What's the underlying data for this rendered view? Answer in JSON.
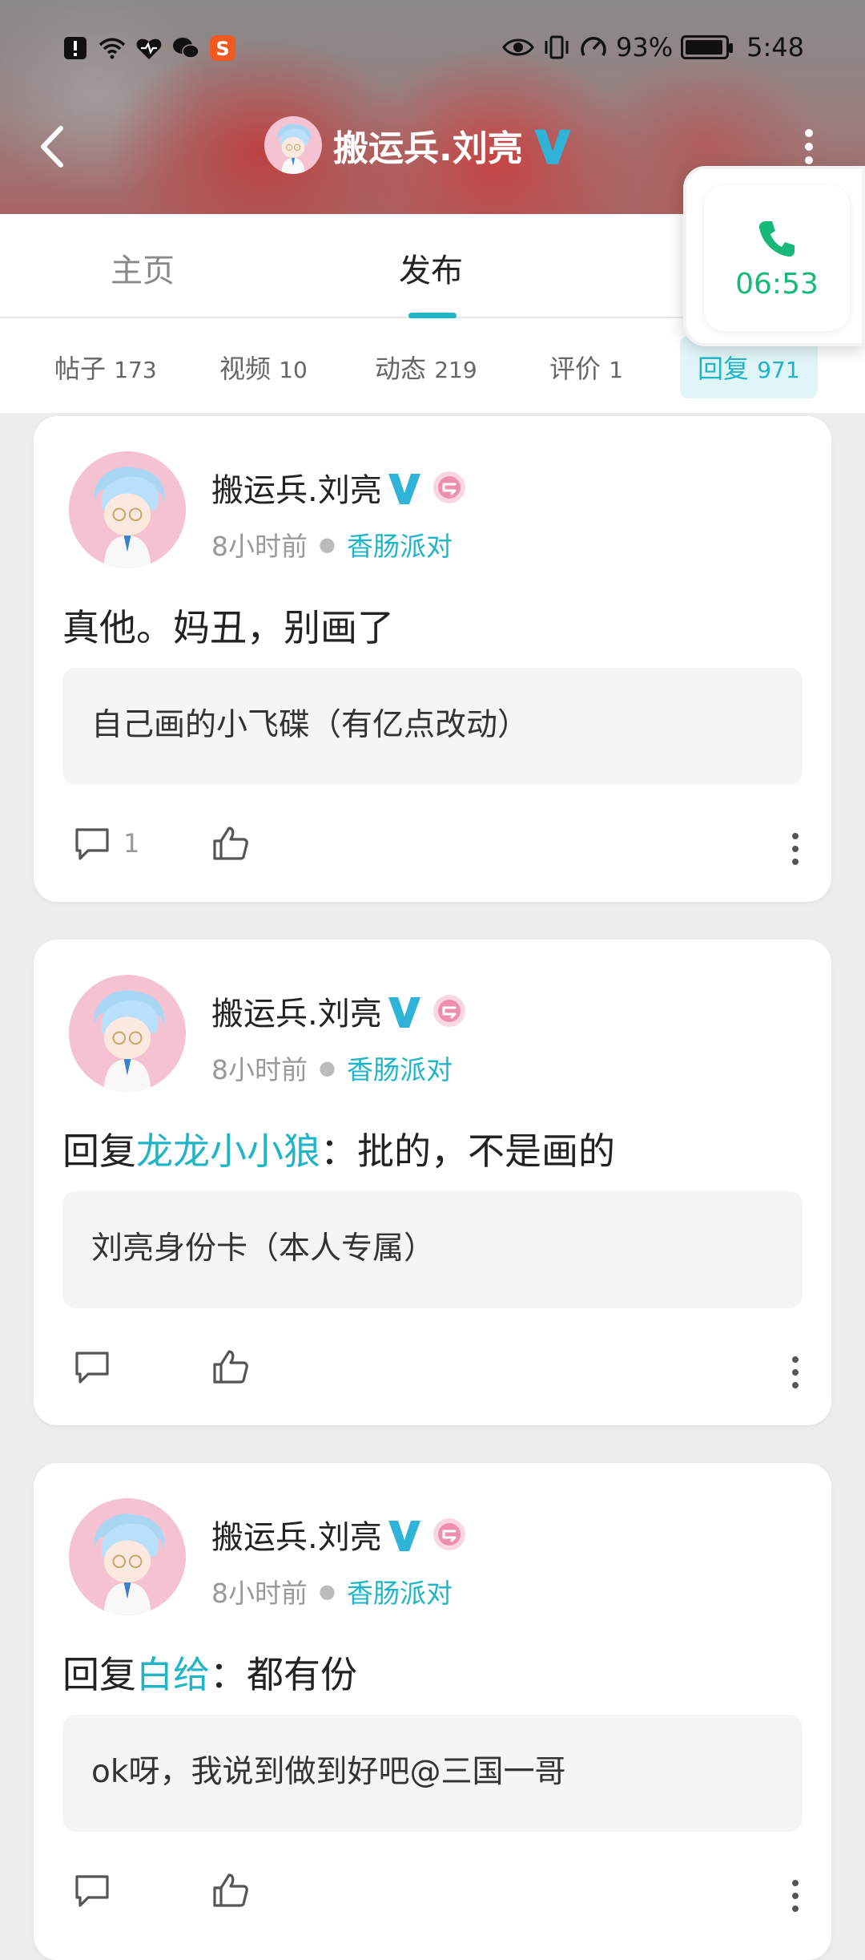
{
  "status_bar": {
    "battery_percent": "93%",
    "time": "5:48",
    "battery_level": 0.93
  },
  "header": {
    "title": "搬运兵.刘亮"
  },
  "call": {
    "timer": "06:53",
    "accent": "#17b978"
  },
  "tabs": [
    {
      "label": "主页"
    },
    {
      "label": "发布"
    }
  ],
  "subtabs": [
    {
      "label": "帖子",
      "count": "173"
    },
    {
      "label": "视频",
      "count": "10"
    },
    {
      "label": "动态",
      "count": "219"
    },
    {
      "label": "评价",
      "count": "1"
    },
    {
      "label": "回复",
      "count": "971"
    }
  ],
  "accent": "#1fb5c6",
  "posts": [
    {
      "author": "搬运兵.刘亮",
      "time": "8小时前",
      "group": "香肠派对",
      "text": "真他。妈丑，别画了",
      "quote": "自己画的小飞碟（有亿点改动）",
      "comments": "1"
    },
    {
      "author": "搬运兵.刘亮",
      "time": "8小时前",
      "group": "香肠派对",
      "reply_prefix": "回复",
      "mention": "龙龙小小狼",
      "text": "：批的，不是画的",
      "quote": "刘亮身份卡（本人专属）"
    },
    {
      "author": "搬运兵.刘亮",
      "time": "8小时前",
      "group": "香肠派对",
      "reply_prefix": "回复",
      "mention": "白给",
      "text": "：都有份",
      "quote": "ok呀，我说到做到好吧@三国一哥"
    }
  ]
}
